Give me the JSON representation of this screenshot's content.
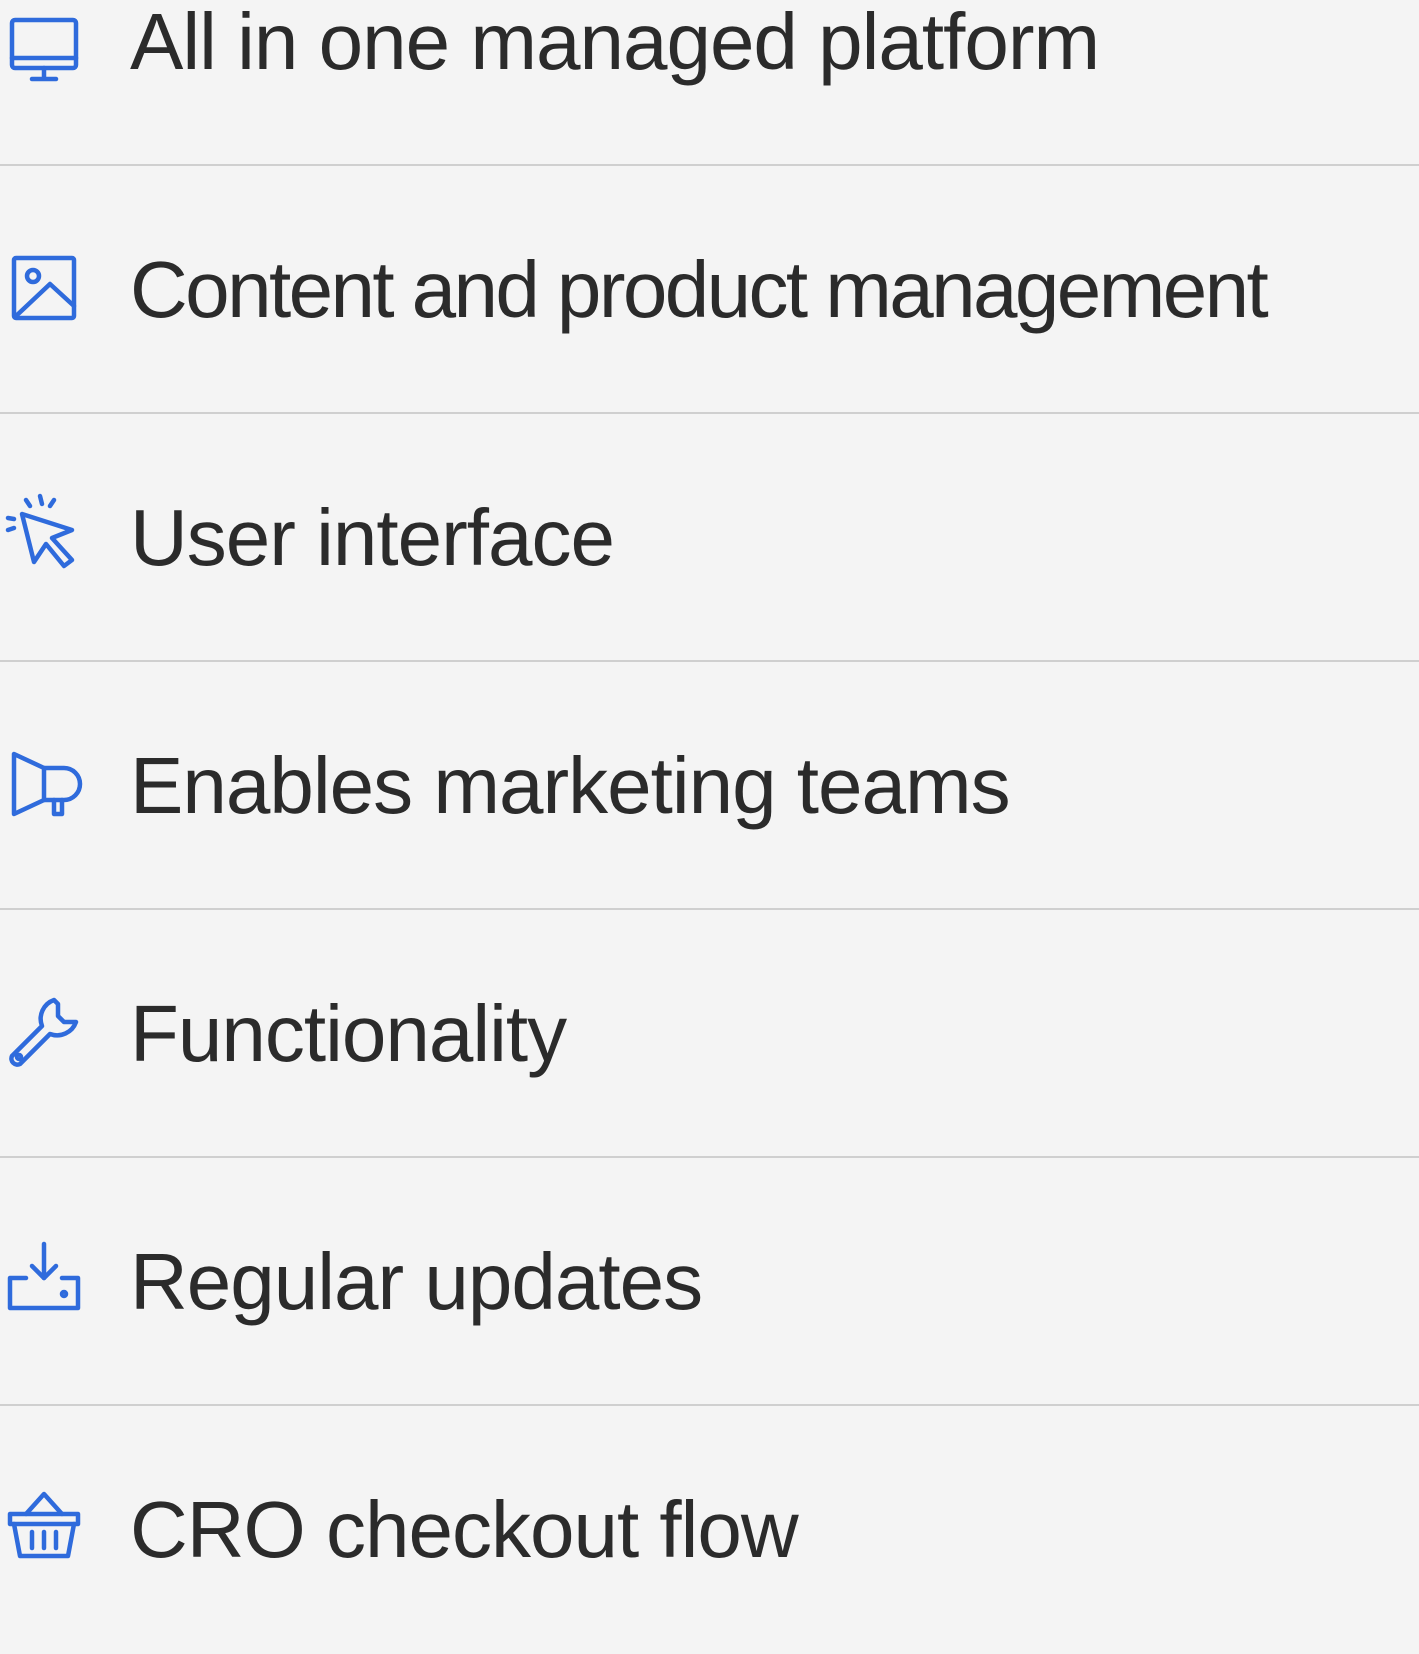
{
  "accent_color": "#2f6bdc",
  "items": [
    {
      "label": "All in one managed platform",
      "icon": "monitor-icon"
    },
    {
      "label": "Content and product management",
      "icon": "image-icon"
    },
    {
      "label": "User interface",
      "icon": "cursor-click-icon"
    },
    {
      "label": "Enables marketing teams",
      "icon": "megaphone-icon"
    },
    {
      "label": "Functionality",
      "icon": "wrench-icon"
    },
    {
      "label": "Regular updates",
      "icon": "download-tray-icon"
    },
    {
      "label": "CRO checkout flow",
      "icon": "basket-icon"
    }
  ]
}
